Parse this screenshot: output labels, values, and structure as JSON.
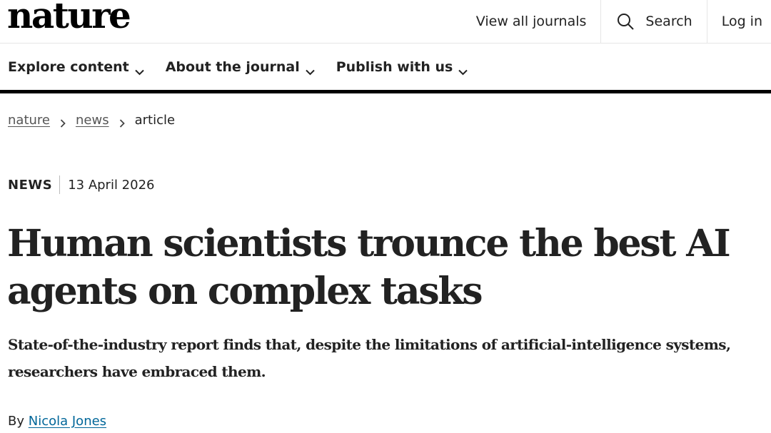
{
  "header": {
    "logo": "nature",
    "links": {
      "view_all_journals": "View all journals",
      "search": "Search",
      "login": "Log in"
    }
  },
  "nav": {
    "items": [
      {
        "label": "Explore content"
      },
      {
        "label": "About the journal"
      },
      {
        "label": "Publish with us"
      }
    ]
  },
  "breadcrumb": {
    "items": [
      "nature",
      "news",
      "article"
    ]
  },
  "article": {
    "type": "NEWS",
    "date": "13 April 2026",
    "title": "Human scientists trounce the best AI agents on complex tasks",
    "standfirst": "State-of-the-industry report finds that, despite the limitations of artificial-intelligence systems, researchers have embraced them.",
    "byline_prefix": "By",
    "author": "Nicola Jones"
  },
  "icons": {
    "search": "search-icon",
    "chevron": "chevron-down-icon",
    "breadcrumb_sep": "chevron-right-icon"
  },
  "colors": {
    "link": "#006699",
    "rule": "#000000"
  }
}
